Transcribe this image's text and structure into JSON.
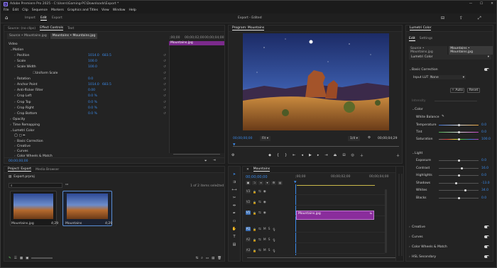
{
  "window": {
    "title": "Adobe Premiere Pro 2025 - C:\\Users\\Gaming-PC\\Downloads\\Export *"
  },
  "menu": [
    "File",
    "Edit",
    "Clip",
    "Sequence",
    "Markers",
    "Graphics and Titles",
    "View",
    "Window",
    "Help"
  ],
  "workspace": {
    "tabs": [
      "Import",
      "Edit",
      "Export"
    ],
    "active": "Edit",
    "center_title": "Export - Edited"
  },
  "effect_controls": {
    "tabs": [
      "Source: (no clips)",
      "Effect Controls",
      "Text"
    ],
    "active_tab": "Effect Controls",
    "clip_tabs": [
      "Source • Mountains.jpg",
      "Mountains • Mountains.jpg"
    ],
    "timecodes": [
      ";00;00",
      "00;00;02;00",
      "00;00;04;00"
    ],
    "clip_bar": "Mountains.jpg",
    "section_video": "Video",
    "fx_motion": "Motion",
    "props": [
      {
        "name": "Position",
        "value": "1014.0",
        "value2": "683.5"
      },
      {
        "name": "Scale",
        "value": "100.0",
        "value2": ""
      },
      {
        "name": "Scale Width",
        "value": "100.0",
        "value2": ""
      },
      {
        "name": "Uniform Scale",
        "value": "",
        "value2": ""
      },
      {
        "name": "Rotation",
        "value": "0.0",
        "value2": ""
      },
      {
        "name": "Anchor Point",
        "value": "1014.0",
        "value2": "683.5"
      },
      {
        "name": "Anti-flicker Filter",
        "value": "0.00",
        "value2": ""
      },
      {
        "name": "Crop Left",
        "value": "0.0 %",
        "value2": ""
      },
      {
        "name": "Crop Top",
        "value": "0.0 %",
        "value2": ""
      },
      {
        "name": "Crop Right",
        "value": "0.0 %",
        "value2": ""
      },
      {
        "name": "Crop Bottom",
        "value": "0.0 %",
        "value2": ""
      }
    ],
    "fx_opacity": "Opacity",
    "fx_time_remap": "Time Remapping",
    "fx_lumetri": "Lumetri Color",
    "lumetri_sub": [
      "Basic Correction",
      "Creative",
      "Curves",
      "Color Wheels & Match"
    ],
    "bottom_timecode": "00;00;00;00"
  },
  "program": {
    "title": "Program: Mountains",
    "timecode": "00;00;00;00",
    "fit": "Fit",
    "resolution": "1/4",
    "duration": "00;00;04;29"
  },
  "project": {
    "tabs": [
      "Project: Export",
      "Media Browser"
    ],
    "file": "Export.prproj",
    "items_label": "1 of 2 items selected",
    "items": [
      {
        "name": "Mountains.jpg",
        "duration": "4;29"
      },
      {
        "name": "Mountains",
        "duration": "4;29"
      }
    ]
  },
  "timeline": {
    "tab": "Mountains",
    "timecode": "00;00;00;00",
    "ruler": [
      ";00;00",
      "00;00;02;00",
      "00;00;04;00"
    ],
    "video_tracks": [
      "V3",
      "V2",
      "V1"
    ],
    "audio_tracks": [
      "A1",
      "A2",
      "A3"
    ],
    "clip_name": "Mountains.jpg",
    "clip_color": "#8a2d9c"
  },
  "lumetri": {
    "title": "Lumetri Color",
    "tabs": [
      "Edit",
      "Settings"
    ],
    "clip_tabs": [
      "Source • Mountains.jpg",
      "Mountains • Mountains.jpg"
    ],
    "effect_select": "Lumetri Color",
    "basic_correction": "Basic Correction",
    "input_lut_label": "Input LUT",
    "input_lut_value": "None",
    "auto_label": "Auto",
    "reset_label": "Reset",
    "intensity_label": "Intensity",
    "color_section": "Color",
    "white_balance": "White Balance",
    "color_params": [
      {
        "name": "Temperature",
        "value": "0.0",
        "pos": 0.5
      },
      {
        "name": "Tint",
        "value": "0.0",
        "pos": 0.5
      },
      {
        "name": "Saturation",
        "value": "100.0",
        "pos": 0.5
      }
    ],
    "light_section": "Light",
    "light_params": [
      {
        "name": "Exposure",
        "value": "0.0",
        "pos": 0.5
      },
      {
        "name": "Contrast",
        "value": "16.0",
        "pos": 0.58
      },
      {
        "name": "Highlights",
        "value": "0.0",
        "pos": 0.5
      },
      {
        "name": "Shadows",
        "value": "-13.0",
        "pos": 0.43
      },
      {
        "name": "Whites",
        "value": "34.0",
        "pos": 0.67
      },
      {
        "name": "Blacks",
        "value": "0.0",
        "pos": 0.5
      }
    ],
    "sections": [
      "Creative",
      "Curves",
      "Color Wheels & Match",
      "HSL Secondary",
      "Vignette"
    ]
  }
}
